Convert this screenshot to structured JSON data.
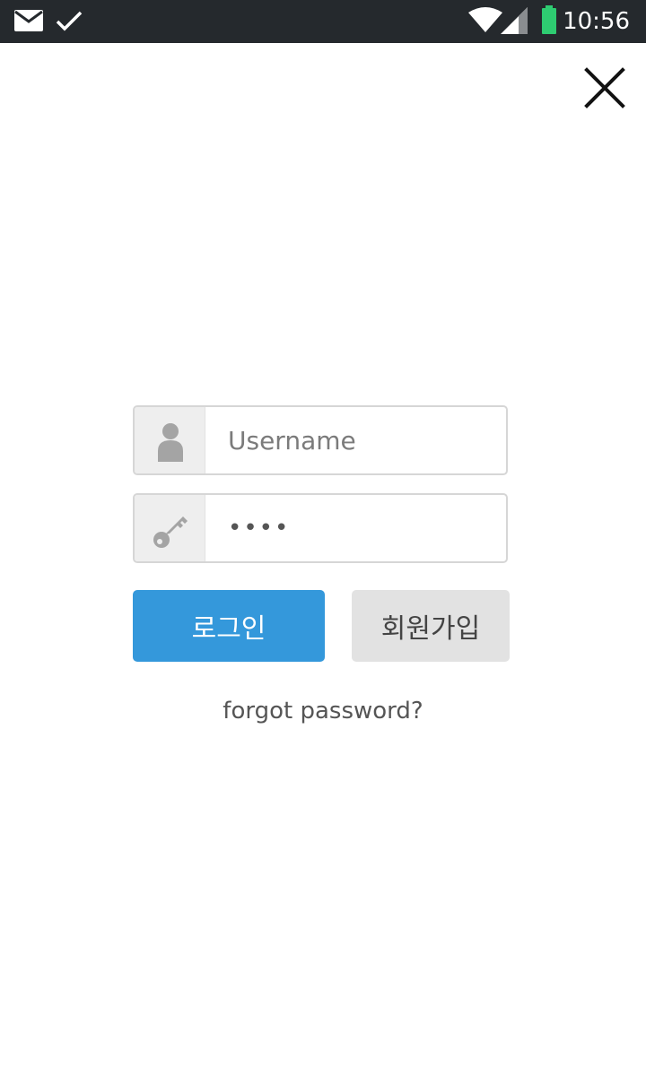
{
  "status_bar": {
    "time": "10:56",
    "icons": [
      "mail-icon",
      "check-icon",
      "wifi-icon",
      "signal-icon",
      "battery-icon"
    ],
    "battery_color": "#2ecc71"
  },
  "login_form": {
    "username": {
      "placeholder": "Username",
      "value": ""
    },
    "password": {
      "value": "••••"
    },
    "login_button": "로그인",
    "signup_button": "회원가입",
    "forgot_link": "forgot password?"
  },
  "colors": {
    "primary": "#3498db",
    "secondary": "#e2e2e2",
    "status_bar_bg": "#25292d"
  }
}
